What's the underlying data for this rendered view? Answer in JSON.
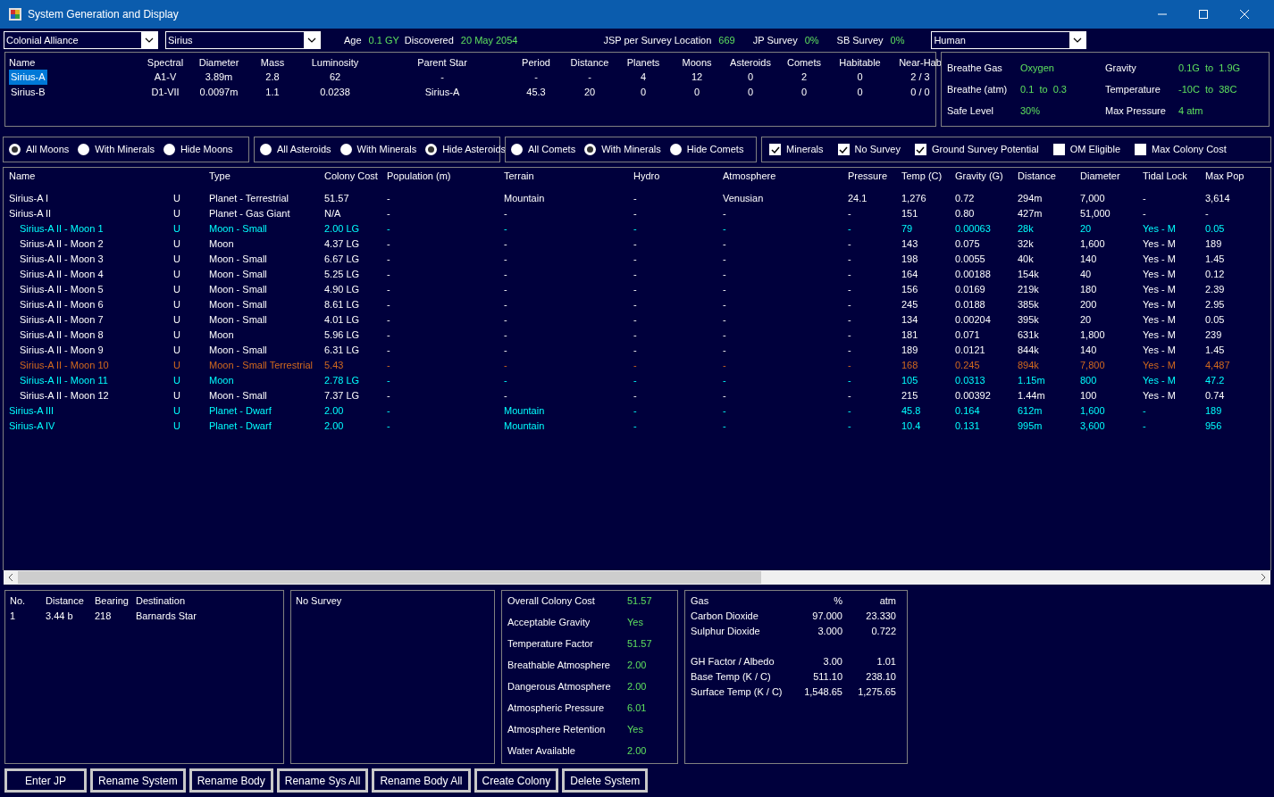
{
  "window": {
    "title": "System Generation and Display"
  },
  "top_bar": {
    "race_select": "Colonial Alliance",
    "system_select": "Sirius",
    "fields": [
      {
        "label": "Age",
        "value": "0.1 GY"
      },
      {
        "label": "Discovered",
        "value": "20 May 2054"
      },
      {
        "label": "JSP per Survey Location",
        "value": "669"
      },
      {
        "label": "JP Survey",
        "value": "0%"
      },
      {
        "label": "SB Survey",
        "value": "0%"
      }
    ],
    "species_select": "Human"
  },
  "stars": {
    "columns": [
      "Name",
      "Spectral",
      "Diameter",
      "Mass",
      "Luminosity",
      "Parent Star",
      "Period",
      "Distance",
      "Planets",
      "Moons",
      "Asteroids",
      "Comets",
      "Habitable",
      "Near-Hab"
    ],
    "rows": [
      {
        "selected": true,
        "cells": [
          "Sirius-A",
          "A1-V",
          "3.89m",
          "2.8",
          "62",
          "-",
          "-",
          "-",
          "4",
          "12",
          "0",
          "2",
          "0",
          "2 / 3"
        ]
      },
      {
        "selected": false,
        "cells": [
          "Sirius-B",
          "D1-VII",
          "0.0097m",
          "1.1",
          "0.0238",
          "Sirius-A",
          "45.3",
          "20",
          "0",
          "0",
          "0",
          "0",
          "0",
          "0 / 0"
        ]
      }
    ]
  },
  "species": [
    {
      "label": "Breathe Gas",
      "value": "Oxygen"
    },
    {
      "label": "Gravity",
      "value": "0.1G  to  1.9G"
    },
    {
      "label": "Breathe (atm)",
      "value": "0.1  to  0.3"
    },
    {
      "label": "Temperature",
      "value": "-10C  to  38C"
    },
    {
      "label": "Safe Level",
      "value": "30%"
    },
    {
      "label": "Max Pressure",
      "value": "4 atm"
    }
  ],
  "filters": {
    "radio_groups": [
      [
        {
          "label": "All Moons",
          "selected": true
        },
        {
          "label": "With Minerals",
          "selected": false
        },
        {
          "label": "Hide Moons",
          "selected": false
        }
      ],
      [
        {
          "label": "All Asteroids",
          "selected": false
        },
        {
          "label": "With Minerals",
          "selected": false
        },
        {
          "label": "Hide Asteroids",
          "selected": true
        }
      ],
      [
        {
          "label": "All Comets",
          "selected": false
        },
        {
          "label": "With Minerals",
          "selected": true
        },
        {
          "label": "Hide Comets",
          "selected": false
        }
      ]
    ],
    "checkboxes": [
      {
        "label": "Minerals",
        "checked": true
      },
      {
        "label": "No Survey",
        "checked": true
      },
      {
        "label": "Ground Survey Potential",
        "checked": true
      },
      {
        "label": "OM Eligible",
        "checked": false
      },
      {
        "label": "Max Colony Cost",
        "checked": false
      }
    ]
  },
  "bodies": {
    "columns": [
      "Name",
      "",
      "Type",
      "Colony Cost",
      "Population (m)",
      "Terrain",
      "Hydro",
      "Atmosphere",
      "Pressure",
      "Temp (C)",
      "Gravity (G)",
      "Distance",
      "Diameter",
      "Tidal Lock",
      "Max Pop"
    ],
    "rows": [
      {
        "color": "#ffffff",
        "cells": [
          "Sirius-A I",
          "U",
          "Planet - Terrestrial",
          "51.57",
          "-",
          "Mountain",
          "-",
          "Venusian",
          "24.1",
          "1,276",
          "0.72",
          "294m",
          "7,000",
          "-",
          "3,614"
        ]
      },
      {
        "color": "#ffffff",
        "cells": [
          "Sirius-A II",
          "U",
          "Planet - Gas Giant",
          "N/A",
          "-",
          "-",
          "-",
          "-",
          "-",
          "151",
          "0.80",
          "427m",
          "51,000",
          "-",
          "-"
        ],
        "children": [
          {
            "color": "#00ffff",
            "cells": [
              "Sirius-A II - Moon 1",
              "U",
              "Moon - Small",
              "2.00 LG",
              "-",
              "-",
              "-",
              "-",
              "-",
              "79",
              "0.00063",
              "28k",
              "20",
              "Yes - M",
              "0.05"
            ]
          },
          {
            "color": "#ffffff",
            "cells": [
              "Sirius-A II - Moon 2",
              "U",
              "Moon",
              "4.37 LG",
              "-",
              "-",
              "-",
              "-",
              "-",
              "143",
              "0.075",
              "32k",
              "1,600",
              "Yes - M",
              "189"
            ]
          },
          {
            "color": "#ffffff",
            "cells": [
              "Sirius-A II - Moon 3",
              "U",
              "Moon - Small",
              "6.67 LG",
              "-",
              "-",
              "-",
              "-",
              "-",
              "198",
              "0.0055",
              "40k",
              "140",
              "Yes - M",
              "1.45"
            ]
          },
          {
            "color": "#ffffff",
            "cells": [
              "Sirius-A II - Moon 4",
              "U",
              "Moon - Small",
              "5.25 LG",
              "-",
              "-",
              "-",
              "-",
              "-",
              "164",
              "0.00188",
              "154k",
              "40",
              "Yes - M",
              "0.12"
            ]
          },
          {
            "color": "#ffffff",
            "cells": [
              "Sirius-A II - Moon 5",
              "U",
              "Moon - Small",
              "4.90 LG",
              "-",
              "-",
              "-",
              "-",
              "-",
              "156",
              "0.0169",
              "219k",
              "180",
              "Yes - M",
              "2.39"
            ]
          },
          {
            "color": "#ffffff",
            "cells": [
              "Sirius-A II - Moon 6",
              "U",
              "Moon - Small",
              "8.61 LG",
              "-",
              "-",
              "-",
              "-",
              "-",
              "245",
              "0.0188",
              "385k",
              "200",
              "Yes - M",
              "2.95"
            ]
          },
          {
            "color": "#ffffff",
            "cells": [
              "Sirius-A II - Moon 7",
              "U",
              "Moon - Small",
              "4.01 LG",
              "-",
              "-",
              "-",
              "-",
              "-",
              "134",
              "0.00204",
              "395k",
              "20",
              "Yes - M",
              "0.05"
            ]
          },
          {
            "color": "#ffffff",
            "cells": [
              "Sirius-A II - Moon 8",
              "U",
              "Moon",
              "5.96 LG",
              "-",
              "-",
              "-",
              "-",
              "-",
              "181",
              "0.071",
              "631k",
              "1,800",
              "Yes - M",
              "239"
            ]
          },
          {
            "color": "#ffffff",
            "cells": [
              "Sirius-A II - Moon 9",
              "U",
              "Moon - Small",
              "6.31 LG",
              "-",
              "-",
              "-",
              "-",
              "-",
              "189",
              "0.0121",
              "844k",
              "140",
              "Yes - M",
              "1.45"
            ]
          },
          {
            "color": "#d2691e",
            "cells": [
              "Sirius-A II - Moon 10",
              "U",
              "Moon - Small Terrestrial",
              "5.43",
              "-",
              "-",
              "-",
              "-",
              "-",
              "168",
              "0.245",
              "894k",
              "7,800",
              "Yes - M",
              "4,487"
            ]
          },
          {
            "color": "#00ffff",
            "cells": [
              "Sirius-A II - Moon 11",
              "U",
              "Moon",
              "2.78 LG",
              "-",
              "-",
              "-",
              "-",
              "-",
              "105",
              "0.0313",
              "1.15m",
              "800",
              "Yes - M",
              "47.2"
            ]
          },
          {
            "color": "#ffffff",
            "cells": [
              "Sirius-A II - Moon 12",
              "U",
              "Moon - Small",
              "7.37 LG",
              "-",
              "-",
              "-",
              "-",
              "-",
              "215",
              "0.00392",
              "1.44m",
              "100",
              "Yes - M",
              "0.74"
            ]
          }
        ]
      },
      {
        "color": "#00ffff",
        "cells": [
          "Sirius-A III",
          "U",
          "Planet - Dwarf",
          "2.00",
          "-",
          "Mountain",
          "-",
          "-",
          "-",
          "45.8",
          "0.164",
          "612m",
          "1,600",
          "-",
          "189"
        ]
      },
      {
        "color": "#00ffff",
        "cells": [
          "Sirius-A IV",
          "U",
          "Planet - Dwarf",
          "2.00",
          "-",
          "Mountain",
          "-",
          "-",
          "-",
          "10.4",
          "0.131",
          "995m",
          "3,600",
          "-",
          "956"
        ]
      }
    ]
  },
  "jump_points": {
    "columns": [
      "No.",
      "Distance",
      "Bearing",
      "Destination"
    ],
    "rows": [
      [
        "1",
        "3.44 b",
        "218",
        "Barnards Star"
      ]
    ]
  },
  "survey": {
    "text": "No Survey"
  },
  "colony_cost": [
    {
      "label": "Overall Colony Cost",
      "value": "51.57"
    },
    {
      "label": "Acceptable Gravity",
      "value": "Yes"
    },
    {
      "label": "Temperature Factor",
      "value": "51.57"
    },
    {
      "label": "Breathable Atmosphere",
      "value": "2.00"
    },
    {
      "label": "Dangerous Atmosphere",
      "value": "2.00"
    },
    {
      "label": "Atmospheric Pressure",
      "value": "6.01"
    },
    {
      "label": "Atmosphere Retention",
      "value": "Yes"
    },
    {
      "label": "Water Available",
      "value": "2.00"
    }
  ],
  "atmosphere": {
    "columns": [
      "Gas",
      "%",
      "atm"
    ],
    "rows": [
      [
        "Carbon Dioxide",
        "97.000",
        "23.330"
      ],
      [
        "Sulphur Dioxide",
        "3.000",
        "0.722"
      ]
    ],
    "thermal": [
      [
        "GH Factor / Albedo",
        "3.00",
        "1.01"
      ],
      [
        "Base Temp (K / C)",
        "511.10",
        "238.10"
      ],
      [
        "Surface Temp (K / C)",
        "1,548.65",
        "1,275.65"
      ]
    ]
  },
  "buttons": [
    "Enter JP",
    "Rename System",
    "Rename Body",
    "Rename Sys All",
    "Rename Body All",
    "Create Colony",
    "Delete System"
  ]
}
